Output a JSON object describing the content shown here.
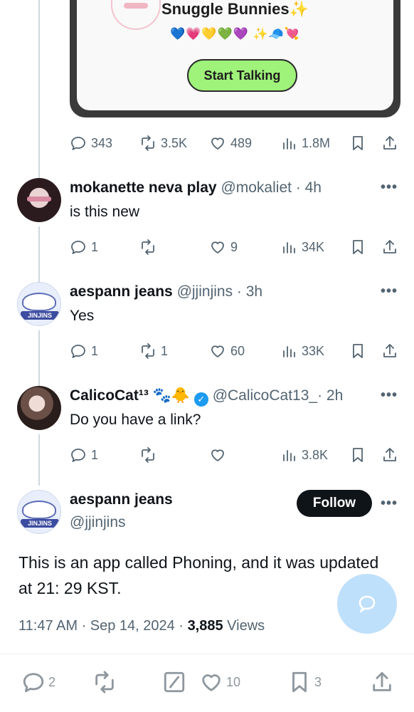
{
  "card": {
    "title": "Snuggle Bunnies",
    "title_sparkle": "✨",
    "emojis": "💙💗💛💚💜 ✨🧢💘",
    "button_label": "Start Talking"
  },
  "tweet_stats": {
    "replies": "343",
    "retweets": "3.5K",
    "likes": "489",
    "views": "1.8M"
  },
  "replies": [
    {
      "name": "mokanette neva play",
      "handle": "@mokaliet · 4h",
      "text": "is this new",
      "replies": "1",
      "retweets": "",
      "likes": "9",
      "views": "34K"
    },
    {
      "name": "aespann jeans",
      "handle": "@jjinjins · 3h",
      "text": "Yes",
      "replies": "1",
      "retweets": "1",
      "likes": "60",
      "views": "33K"
    },
    {
      "name": "CalicoCat¹³",
      "name_emojis": "🐾🐥",
      "handle": "@CalicoCat13_· 2h",
      "text": "Do you have a link?",
      "replies": "1",
      "retweets": "",
      "likes": "",
      "views": "3.8K"
    }
  ],
  "main_tweet": {
    "name": "aespann jeans",
    "handle": "@jjinjins",
    "follow_label": "Follow",
    "text": "This is an app called Phoning, and it was updated at 21: 29 KST.",
    "time": "11:47 AM · Sep 14, 2024 · ",
    "views_count": "3,885",
    "views_label": " Views"
  },
  "avatar_band_text": "JINJINS",
  "bottom_bar": {
    "replies": "2",
    "likes": "10",
    "bookmarks": "3"
  },
  "colors": {
    "accent": "#1d9bf0",
    "text": "#0f1419",
    "muted": "#536471",
    "button_green": "#9ff27a"
  }
}
